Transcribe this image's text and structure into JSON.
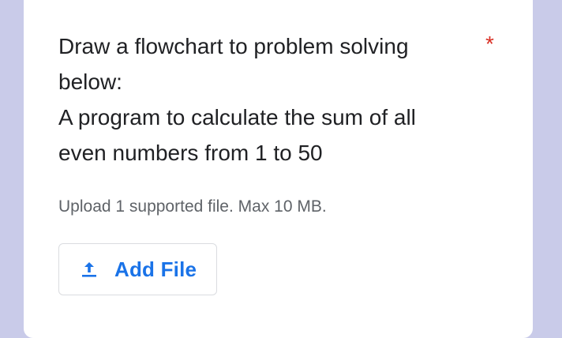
{
  "question": {
    "lines": [
      "Draw a flowchart to problem solving",
      "below:",
      "A program to calculate the sum of all",
      "even numbers from 1 to 50"
    ],
    "required_marker": "*"
  },
  "upload": {
    "hint": "Upload 1 supported file. Max 10 MB.",
    "button_label": "Add File",
    "button_icon": "upload-icon"
  },
  "colors": {
    "page_background": "#c9cbe9",
    "card_background": "#ffffff",
    "text": "#202124",
    "required": "#d93025",
    "secondary_text": "#5f6368",
    "accent": "#1a73e8"
  }
}
